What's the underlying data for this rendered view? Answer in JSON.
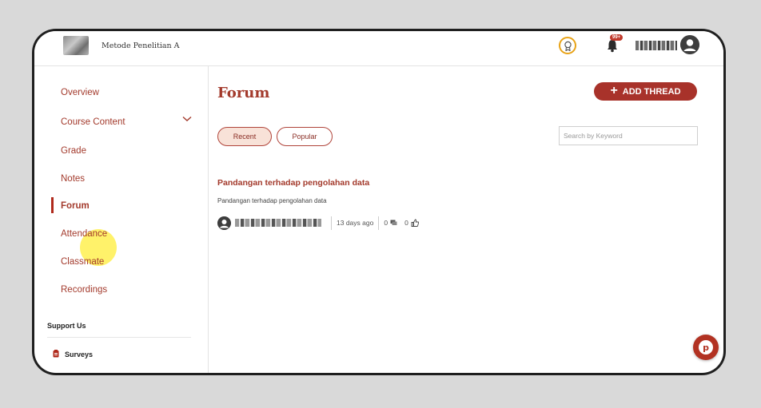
{
  "header": {
    "course_title": "Metode Penelitian A",
    "notification_badge": "99+",
    "icons": [
      "course-thumbnail",
      "award-icon",
      "bell-icon",
      "user-avatar-icon"
    ]
  },
  "sidebar": {
    "items": [
      {
        "label": "Overview"
      },
      {
        "label": "Course Content"
      },
      {
        "label": "Grade"
      },
      {
        "label": "Notes"
      },
      {
        "label": "Forum"
      },
      {
        "label": "Attendance"
      },
      {
        "label": "Classmate"
      },
      {
        "label": "Recordings"
      }
    ],
    "active": "Forum",
    "support_heading": "Support Us",
    "support_items": [
      {
        "label": "Surveys"
      }
    ]
  },
  "main": {
    "title": "Forum",
    "add_thread_label": "ADD THREAD",
    "tabs": [
      {
        "label": "Recent",
        "selected": true
      },
      {
        "label": "Popular",
        "selected": false
      }
    ],
    "search_placeholder": "Search by Keyword",
    "threads": [
      {
        "title": "Pandangan terhadap pengolahan data",
        "description": "Pandangan terhadap pengolahan data",
        "time": "13 days ago",
        "comments": "0",
        "likes": "0"
      }
    ]
  },
  "colors": {
    "accent": "#a8322a",
    "tab_selected_bg": "#f8e2d8",
    "award": "#e8a317"
  }
}
